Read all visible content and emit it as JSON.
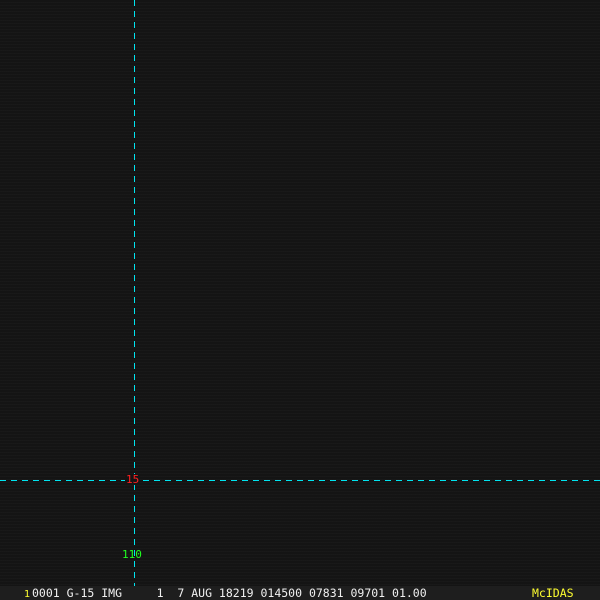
{
  "overlay": {
    "lat_label": "15",
    "lon_label": "110",
    "line_color": "#00e5f0"
  },
  "status_bar": {
    "frame_number": "1",
    "info": "0001 G-15 IMG     1  7 AUG 18219 014500 07831 09701 01.00",
    "brand": "McIDAS",
    "brand_color": "#ffff30"
  }
}
